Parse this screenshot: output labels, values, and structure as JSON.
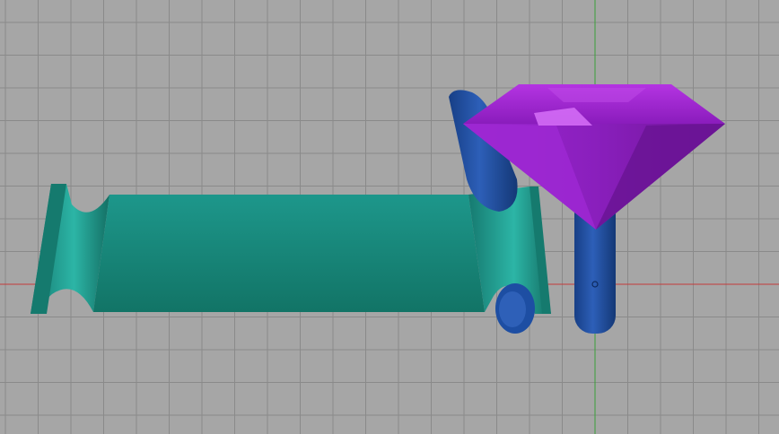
{
  "viewport": {
    "view": "front",
    "background_color": "#a6a6a6",
    "grid_color": "#8a8a8a",
    "grid_visible": true,
    "axis_x_color": "#c43a3a",
    "axis_y_color": "#3aa03a"
  },
  "objects": [
    {
      "name": "ring-shank",
      "color": "#1c8f83"
    },
    {
      "name": "prong-left",
      "color": "#1f4fa3"
    },
    {
      "name": "prong-right",
      "color": "#1f4fa3"
    },
    {
      "name": "gemstone",
      "color": "#9a1fc8",
      "shape": "round-brilliant-diamond"
    }
  ]
}
